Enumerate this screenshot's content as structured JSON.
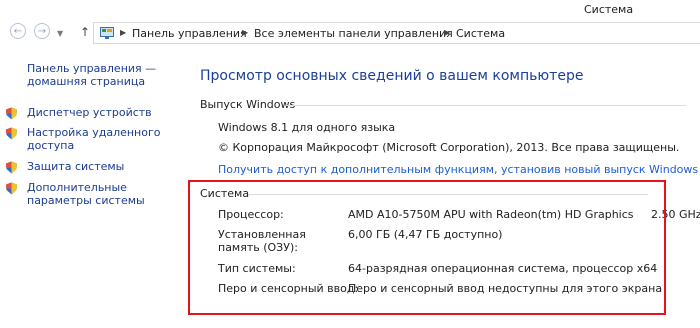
{
  "window": {
    "title": "Система"
  },
  "nav": {
    "back_icon": "back-arrow-icon",
    "forward_icon": "forward-arrow-icon",
    "breadcrumb": [
      "Панель управления",
      "Все элементы панели управления",
      "Система"
    ]
  },
  "sidebar": {
    "home_link": "Панель управления — домашняя страница",
    "items": [
      {
        "label": "Диспетчер устройств",
        "icon": "shield-icon"
      },
      {
        "label": "Настройка удаленного доступа",
        "icon": "shield-icon"
      },
      {
        "label": "Защита системы",
        "icon": "shield-icon"
      },
      {
        "label": "Дополнительные параметры системы",
        "icon": "shield-icon"
      }
    ]
  },
  "main": {
    "heading": "Просмотр основных сведений о вашем компьютере",
    "windows_section": {
      "title": "Выпуск Windows",
      "edition": "Windows 8.1 для одного языка",
      "copyright": "© Корпорация Майкрософт (Microsoft Corporation), 2013. Все права защищены.",
      "upgrade_link": "Получить доступ к дополнительным функциям, установив новый выпуск Windows"
    },
    "system_section": {
      "title": "Система",
      "rows": [
        {
          "label": "Процессор:",
          "value": "AMD A10-5750M APU with Radeon(tm) HD Graphics     2.50 GHz"
        },
        {
          "label": "Установленная память (ОЗУ):",
          "value": "6,00 ГБ (4,47 ГБ доступно)"
        },
        {
          "label": "Тип системы:",
          "value": "64-разрядная операционная система, процессор x64"
        },
        {
          "label": "Перо и сенсорный ввод:",
          "value": "Перо и сенсорный ввод недоступны для этого экрана"
        }
      ]
    }
  },
  "colors": {
    "link": "#1b5ed1",
    "heading": "#1a3f9a",
    "highlight": "#e8121a"
  }
}
